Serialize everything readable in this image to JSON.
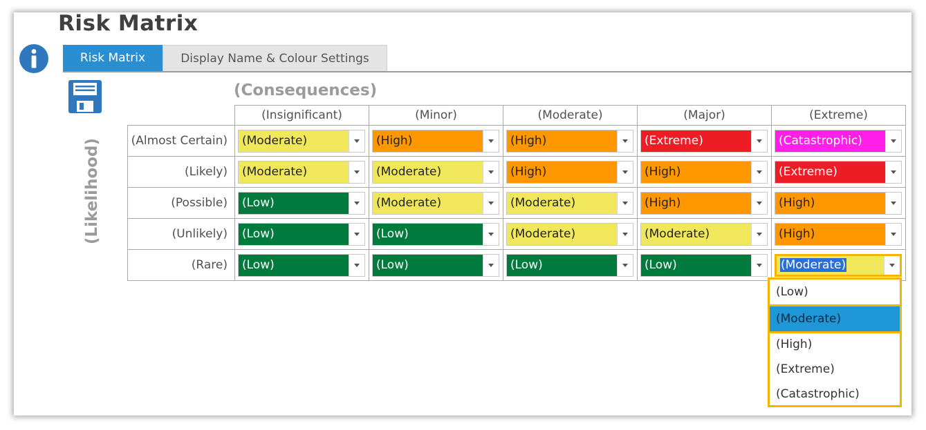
{
  "page": {
    "title": "Risk Matrix"
  },
  "tabs": [
    {
      "label": "Risk Matrix",
      "active": true
    },
    {
      "label": "Display Name & Colour Settings",
      "active": false
    }
  ],
  "axes": {
    "consequences": "(Consequences)",
    "likelihood": "(Likelihood)"
  },
  "columns": [
    "(Insignificant)",
    "(Minor)",
    "(Moderate)",
    "(Major)",
    "(Extreme)"
  ],
  "level_colors": {
    "(Low)": {
      "bg": "#007a3d",
      "fg": "#ffffff"
    },
    "(Moderate)": {
      "bg": "#f0e85a",
      "fg": "#222222"
    },
    "(High)": {
      "bg": "#ff9800",
      "fg": "#222222"
    },
    "(Extreme)": {
      "bg": "#ee1c25",
      "fg": "#ffffff"
    },
    "(Catastrophic)": {
      "bg": "#ff1fe8",
      "fg": "#ffffff"
    }
  },
  "rows": [
    {
      "label": "(Almost Certain)",
      "values": [
        "(Moderate)",
        "(High)",
        "(High)",
        "(Extreme)",
        "(Catastrophic)"
      ]
    },
    {
      "label": "(Likely)",
      "values": [
        "(Moderate)",
        "(Moderate)",
        "(High)",
        "(High)",
        "(Extreme)"
      ]
    },
    {
      "label": "(Possible)",
      "values": [
        "(Low)",
        "(Moderate)",
        "(Moderate)",
        "(High)",
        "(High)"
      ]
    },
    {
      "label": "(Unlikely)",
      "values": [
        "(Low)",
        "(Low)",
        "(Moderate)",
        "(Moderate)",
        "(High)"
      ]
    },
    {
      "label": "(Rare)",
      "values": [
        "(Low)",
        "(Low)",
        "(Low)",
        "(Low)",
        "(Moderate)"
      ]
    }
  ],
  "dropdown": {
    "options": [
      "(Low)",
      "(Moderate)",
      "(High)",
      "(Extreme)",
      "(Catastrophic)"
    ],
    "selected": "(Moderate)"
  }
}
